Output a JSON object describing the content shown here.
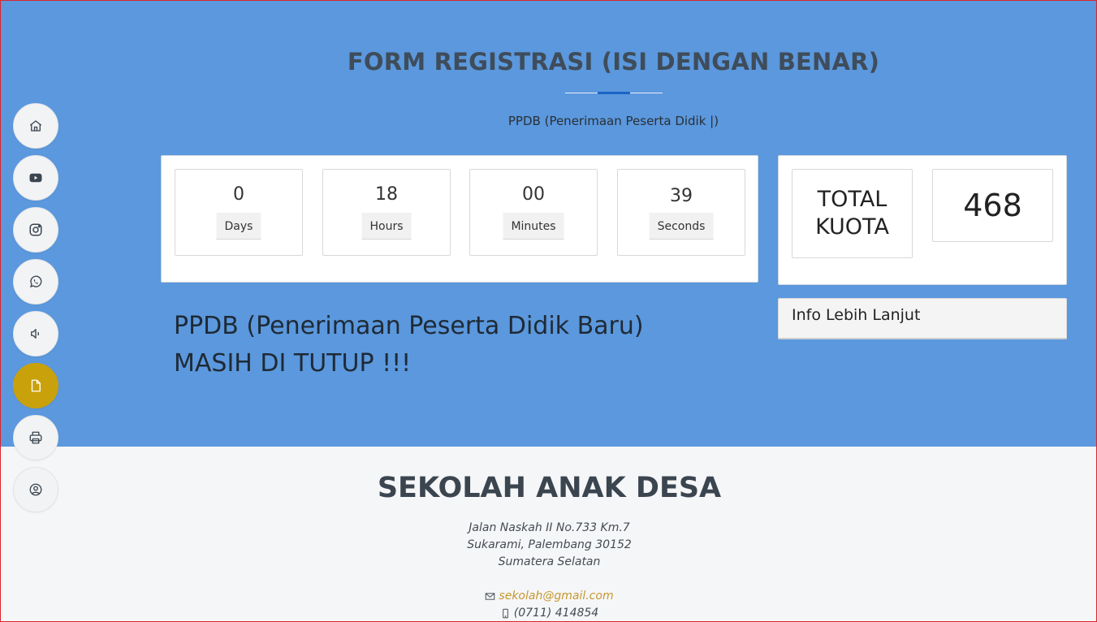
{
  "hero": {
    "title": "FORM REGISTRASI (ISI DENGAN BENAR)",
    "subtitle": "PPDB (Penerimaan Peserta Didik |)"
  },
  "countdown": [
    {
      "value": "0",
      "label": "Days"
    },
    {
      "value": "18",
      "label": "Hours"
    },
    {
      "value": "00",
      "label": "Minutes"
    },
    {
      "value": "39",
      "label": "Seconds"
    }
  ],
  "kuota": {
    "label": "TOTAL KUOTA",
    "value": "468"
  },
  "info": {
    "label": "Info Lebih Lanjut"
  },
  "notice": {
    "line1": "PPDB (Penerimaan Peserta Didik Baru)",
    "line2": "MASIH DI TUTUP !!!"
  },
  "sidebar": {
    "items": [
      {
        "icon": "home-icon"
      },
      {
        "icon": "youtube-icon"
      },
      {
        "icon": "instagram-icon"
      },
      {
        "icon": "whatsapp-icon"
      },
      {
        "icon": "speaker-icon"
      },
      {
        "icon": "document-icon",
        "active": true
      },
      {
        "icon": "printer-icon"
      },
      {
        "icon": "user-circle-icon"
      }
    ],
    "active_color": "#c9a10a"
  },
  "footer": {
    "school_name": "SEKOLAH ANAK DESA",
    "address_line1": "Jalan Naskah II No.733 Km.7",
    "address_line2": "Sukarami, Palembang 30152",
    "address_line3": "Sumatera Selatan",
    "email": "sekolah@gmail.com",
    "phone": "(0711) 414854"
  },
  "colors": {
    "hero_bg": "#5b98dd",
    "accent": "#1a64c8",
    "email_link": "#c7972c"
  }
}
